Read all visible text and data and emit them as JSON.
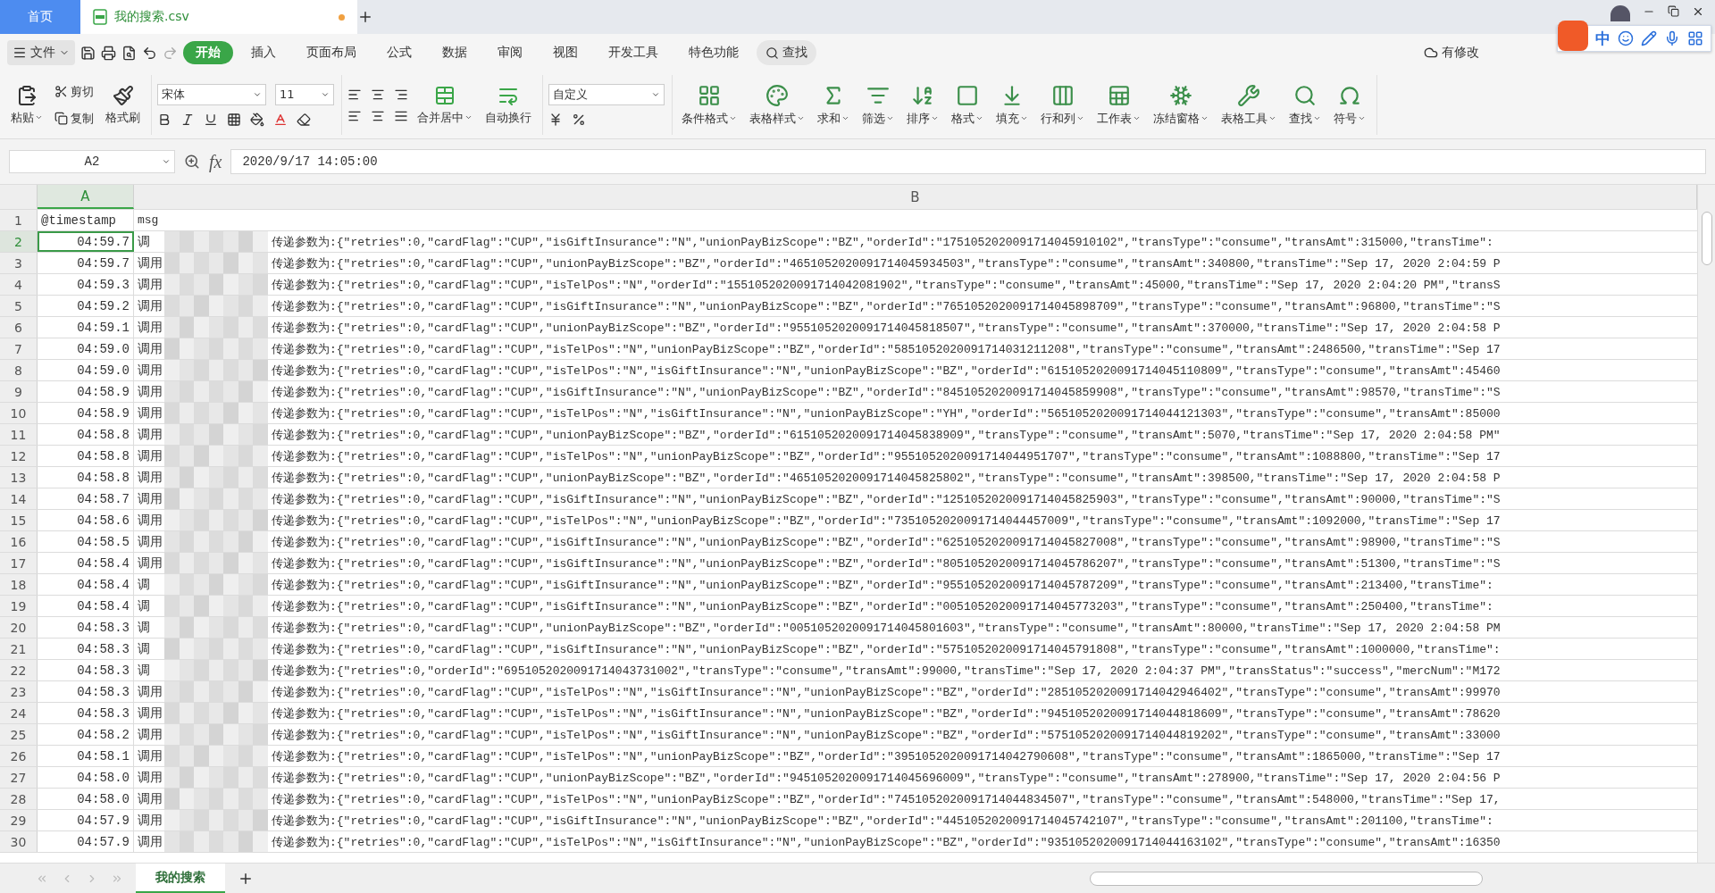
{
  "tabs": [
    {
      "label": "首页",
      "kind": "home",
      "selected": false
    },
    {
      "label": "我的搜索.csv",
      "kind": "file",
      "selected": true,
      "modified": true
    }
  ],
  "ime": {
    "mode": "中"
  },
  "menu": {
    "file": "文件",
    "items": [
      {
        "label": "开始",
        "selected": true
      },
      {
        "label": "插入",
        "selected": false
      },
      {
        "label": "页面布局",
        "selected": false
      },
      {
        "label": "公式",
        "selected": false
      },
      {
        "label": "数据",
        "selected": false
      },
      {
        "label": "审阅",
        "selected": false
      },
      {
        "label": "视图",
        "selected": false
      },
      {
        "label": "开发工具",
        "selected": false
      },
      {
        "label": "特色功能",
        "selected": false
      }
    ],
    "search": "查找",
    "changes": "有修改"
  },
  "ribbon": {
    "paste": "粘贴",
    "cut": "剪切",
    "copy": "复制",
    "format_painter": "格式刷",
    "font_name": "宋体",
    "font_size": "11",
    "merge": "合并居中",
    "wrap": "自动换行",
    "number_format": "自定义",
    "tools": [
      "条件格式",
      "表格样式",
      "求和",
      "筛选",
      "排序",
      "格式",
      "填充",
      "行和列",
      "工作表",
      "冻结窗格",
      "表格工具",
      "查找",
      "符号"
    ]
  },
  "formula_bar": {
    "cell": "A2",
    "fx": "fx",
    "value": "2020/9/17 14:05:00"
  },
  "sheet": {
    "columns": [
      "A",
      "B"
    ],
    "header_row": {
      "number": "1",
      "cells": [
        "@timestamp",
        "msg"
      ]
    },
    "rows": [
      {
        "number": "2",
        "kind": "data",
        "timestamp": "04:59.7",
        "prefix": "调",
        "msg": "传递参数为:{\"retries\":0,\"cardFlag\":\"CUP\",\"isGiftInsurance\":\"N\",\"unionPayBizScope\":\"BZ\",\"orderId\":\"1751052020091714045910102\",\"transType\":\"consume\",\"transAmt\":315000,\"transTime\":",
        "selected": true
      },
      {
        "number": "3",
        "kind": "data",
        "timestamp": "04:59.7",
        "prefix": "调用",
        "msg": "传递参数为:{\"retries\":0,\"cardFlag\":\"CUP\",\"unionPayBizScope\":\"BZ\",\"orderId\":\"4651052020091714045934503\",\"transType\":\"consume\",\"transAmt\":340800,\"transTime\":\"Sep 17, 2020 2:04:59 P",
        "selected": false
      },
      {
        "number": "4",
        "kind": "data",
        "timestamp": "04:59.3",
        "prefix": "调用",
        "msg": "传递参数为:{\"retries\":0,\"cardFlag\":\"CUP\",\"isTelPos\":\"N\",\"orderId\":\"1551052020091714042081902\",\"transType\":\"consume\",\"transAmt\":45000,\"transTime\":\"Sep 17, 2020 2:04:20 PM\",\"transS",
        "selected": false
      },
      {
        "number": "5",
        "kind": "data",
        "timestamp": "04:59.2",
        "prefix": "调用",
        "msg": "传递参数为:{\"retries\":0,\"cardFlag\":\"CUP\",\"isGiftInsurance\":\"N\",\"unionPayBizScope\":\"BZ\",\"orderId\":\"7651052020091714045898709\",\"transType\":\"consume\",\"transAmt\":96800,\"transTime\":\"S",
        "selected": false
      },
      {
        "number": "6",
        "kind": "data",
        "timestamp": "04:59.1",
        "prefix": "调用",
        "msg": "传递参数为:{\"retries\":0,\"cardFlag\":\"CUP\",\"unionPayBizScope\":\"BZ\",\"orderId\":\"9551052020091714045818507\",\"transType\":\"consume\",\"transAmt\":370000,\"transTime\":\"Sep 17, 2020 2:04:58 P",
        "selected": false
      },
      {
        "number": "7",
        "kind": "data",
        "timestamp": "04:59.0",
        "prefix": "调用",
        "msg": "传递参数为:{\"retries\":0,\"cardFlag\":\"CUP\",\"isTelPos\":\"N\",\"unionPayBizScope\":\"BZ\",\"orderId\":\"5851052020091714031211208\",\"transType\":\"consume\",\"transAmt\":2486500,\"transTime\":\"Sep 17",
        "selected": false
      },
      {
        "number": "8",
        "kind": "data",
        "timestamp": "04:59.0",
        "prefix": "调用",
        "msg": "传递参数为:{\"retries\":0,\"cardFlag\":\"CUP\",\"isTelPos\":\"N\",\"isGiftInsurance\":\"N\",\"unionPayBizScope\":\"BZ\",\"orderId\":\"6151052020091714045110809\",\"transType\":\"consume\",\"transAmt\":45460",
        "selected": false
      },
      {
        "number": "9",
        "kind": "data",
        "timestamp": "04:58.9",
        "prefix": "调用",
        "msg": "传递参数为:{\"retries\":0,\"cardFlag\":\"CUP\",\"isGiftInsurance\":\"N\",\"unionPayBizScope\":\"BZ\",\"orderId\":\"8451052020091714045859908\",\"transType\":\"consume\",\"transAmt\":98570,\"transTime\":\"S",
        "selected": false
      },
      {
        "number": "10",
        "kind": "data",
        "timestamp": "04:58.9",
        "prefix": "调用",
        "msg": "传递参数为:{\"retries\":0,\"cardFlag\":\"CUP\",\"isTelPos\":\"N\",\"isGiftInsurance\":\"N\",\"unionPayBizScope\":\"YH\",\"orderId\":\"5651052020091714044121303\",\"transType\":\"consume\",\"transAmt\":85000",
        "selected": false
      },
      {
        "number": "11",
        "kind": "data",
        "timestamp": "04:58.8",
        "prefix": "调用",
        "msg": "传递参数为:{\"retries\":0,\"cardFlag\":\"CUP\",\"unionPayBizScope\":\"BZ\",\"orderId\":\"6151052020091714045838909\",\"transType\":\"consume\",\"transAmt\":5070,\"transTime\":\"Sep 17, 2020 2:04:58 PM\"",
        "selected": false
      },
      {
        "number": "12",
        "kind": "data",
        "timestamp": "04:58.8",
        "prefix": "调用",
        "msg": "传递参数为:{\"retries\":0,\"cardFlag\":\"CUP\",\"isTelPos\":\"N\",\"unionPayBizScope\":\"BZ\",\"orderId\":\"9551052020091714044951707\",\"transType\":\"consume\",\"transAmt\":1088800,\"transTime\":\"Sep 17",
        "selected": false
      },
      {
        "number": "13",
        "kind": "data",
        "timestamp": "04:58.8",
        "prefix": "调用",
        "msg": "传递参数为:{\"retries\":0,\"cardFlag\":\"CUP\",\"unionPayBizScope\":\"BZ\",\"orderId\":\"4651052020091714045825802\",\"transType\":\"consume\",\"transAmt\":398500,\"transTime\":\"Sep 17, 2020 2:04:58 P",
        "selected": false
      },
      {
        "number": "14",
        "kind": "data",
        "timestamp": "04:58.7",
        "prefix": "调用",
        "msg": "传递参数为:{\"retries\":0,\"cardFlag\":\"CUP\",\"isGiftInsurance\":\"N\",\"unionPayBizScope\":\"BZ\",\"orderId\":\"1251052020091714045825903\",\"transType\":\"consume\",\"transAmt\":90000,\"transTime\":\"S",
        "selected": false
      },
      {
        "number": "15",
        "kind": "data",
        "timestamp": "04:58.6",
        "prefix": "调用",
        "msg": "传递参数为:{\"retries\":0,\"cardFlag\":\"CUP\",\"isTelPos\":\"N\",\"unionPayBizScope\":\"BZ\",\"orderId\":\"7351052020091714044457009\",\"transType\":\"consume\",\"transAmt\":1092000,\"transTime\":\"Sep 17",
        "selected": false
      },
      {
        "number": "16",
        "kind": "data",
        "timestamp": "04:58.5",
        "prefix": "调用",
        "msg": "传递参数为:{\"retries\":0,\"cardFlag\":\"CUP\",\"isGiftInsurance\":\"N\",\"unionPayBizScope\":\"BZ\",\"orderId\":\"6251052020091714045827008\",\"transType\":\"consume\",\"transAmt\":98900,\"transTime\":\"S",
        "selected": false
      },
      {
        "number": "17",
        "kind": "data",
        "timestamp": "04:58.4",
        "prefix": "调用",
        "msg": "传递参数为:{\"retries\":0,\"cardFlag\":\"CUP\",\"isGiftInsurance\":\"N\",\"unionPayBizScope\":\"BZ\",\"orderId\":\"8051052020091714045786207\",\"transType\":\"consume\",\"transAmt\":51300,\"transTime\":\"S",
        "selected": false
      },
      {
        "number": "18",
        "kind": "data",
        "timestamp": "04:58.4",
        "prefix": "调",
        "msg": "传递参数为:{\"retries\":0,\"cardFlag\":\"CUP\",\"isGiftInsurance\":\"N\",\"unionPayBizScope\":\"BZ\",\"orderId\":\"9551052020091714045787209\",\"transType\":\"consume\",\"transAmt\":213400,\"transTime\":",
        "selected": false
      },
      {
        "number": "19",
        "kind": "data",
        "timestamp": "04:58.4",
        "prefix": "调",
        "msg": "传递参数为:{\"retries\":0,\"cardFlag\":\"CUP\",\"isGiftInsurance\":\"N\",\"unionPayBizScope\":\"BZ\",\"orderId\":\"0051052020091714045773203\",\"transType\":\"consume\",\"transAmt\":250400,\"transTime\":",
        "selected": false
      },
      {
        "number": "20",
        "kind": "data",
        "timestamp": "04:58.3",
        "prefix": "调",
        "msg": "传递参数为:{\"retries\":0,\"cardFlag\":\"CUP\",\"unionPayBizScope\":\"BZ\",\"orderId\":\"0051052020091714045801603\",\"transType\":\"consume\",\"transAmt\":80000,\"transTime\":\"Sep 17, 2020 2:04:58 PM",
        "selected": false
      },
      {
        "number": "21",
        "kind": "data",
        "timestamp": "04:58.3",
        "prefix": "调",
        "msg": "传递参数为:{\"retries\":0,\"cardFlag\":\"CUP\",\"isGiftInsurance\":\"N\",\"unionPayBizScope\":\"BZ\",\"orderId\":\"5751052020091714045791808\",\"transType\":\"consume\",\"transAmt\":1000000,\"transTime\":",
        "selected": false
      },
      {
        "number": "22",
        "kind": "data",
        "timestamp": "04:58.3",
        "prefix": "调",
        "msg": "传递参数为:{\"retries\":0,\"orderId\":\"6951052020091714043731002\",\"transType\":\"consume\",\"transAmt\":99000,\"transTime\":\"Sep 17, 2020 2:04:37 PM\",\"transStatus\":\"success\",\"mercNum\":\"M172",
        "selected": false
      },
      {
        "number": "23",
        "kind": "data",
        "timestamp": "04:58.3",
        "prefix": "调用",
        "msg": "传递参数为:{\"retries\":0,\"cardFlag\":\"CUP\",\"isTelPos\":\"N\",\"isGiftInsurance\":\"N\",\"unionPayBizScope\":\"BZ\",\"orderId\":\"2851052020091714042946402\",\"transType\":\"consume\",\"transAmt\":99970",
        "selected": false
      },
      {
        "number": "24",
        "kind": "data",
        "timestamp": "04:58.3",
        "prefix": "调用",
        "msg": "传递参数为:{\"retries\":0,\"cardFlag\":\"CUP\",\"isTelPos\":\"N\",\"isGiftInsurance\":\"N\",\"unionPayBizScope\":\"BZ\",\"orderId\":\"9451052020091714044818609\",\"transType\":\"consume\",\"transAmt\":78620",
        "selected": false
      },
      {
        "number": "25",
        "kind": "data",
        "timestamp": "04:58.2",
        "prefix": "调用",
        "msg": "传递参数为:{\"retries\":0,\"cardFlag\":\"CUP\",\"isTelPos\":\"N\",\"isGiftInsurance\":\"N\",\"unionPayBizScope\":\"BZ\",\"orderId\":\"5751052020091714044819202\",\"transType\":\"consume\",\"transAmt\":33000",
        "selected": false
      },
      {
        "number": "26",
        "kind": "data",
        "timestamp": "04:58.1",
        "prefix": "调用",
        "msg": "传递参数为:{\"retries\":0,\"cardFlag\":\"CUP\",\"isTelPos\":\"N\",\"unionPayBizScope\":\"BZ\",\"orderId\":\"3951052020091714042790608\",\"transType\":\"consume\",\"transAmt\":1865000,\"transTime\":\"Sep 17",
        "selected": false
      },
      {
        "number": "27",
        "kind": "data",
        "timestamp": "04:58.0",
        "prefix": "调用",
        "msg": "传递参数为:{\"retries\":0,\"cardFlag\":\"CUP\",\"unionPayBizScope\":\"BZ\",\"orderId\":\"9451052020091714045696009\",\"transType\":\"consume\",\"transAmt\":278900,\"transTime\":\"Sep 17, 2020 2:04:56 P",
        "selected": false
      },
      {
        "number": "28",
        "kind": "data",
        "timestamp": "04:58.0",
        "prefix": "调用",
        "msg": "传递参数为:{\"retries\":0,\"cardFlag\":\"CUP\",\"isTelPos\":\"N\",\"unionPayBizScope\":\"BZ\",\"orderId\":\"7451052020091714044834507\",\"transType\":\"consume\",\"transAmt\":548000,\"transTime\":\"Sep 17,",
        "selected": false
      },
      {
        "number": "29",
        "kind": "data",
        "timestamp": "04:57.9",
        "prefix": "调用",
        "msg": "传递参数为:{\"retries\":0,\"cardFlag\":\"CUP\",\"isGiftInsurance\":\"N\",\"unionPayBizScope\":\"BZ\",\"orderId\":\"4451052020091714045742107\",\"transType\":\"consume\",\"transAmt\":201100,\"transTime\":",
        "selected": false
      },
      {
        "number": "30",
        "kind": "data",
        "timestamp": "04:57.9",
        "prefix": "调用",
        "msg": "传递参数为:{\"retries\":0,\"cardFlag\":\"CUP\",\"isTelPos\":\"N\",\"isGiftInsurance\":\"N\",\"unionPayBizScope\":\"BZ\",\"orderId\":\"9351052020091714044163102\",\"transType\":\"consume\",\"transAmt\":16350",
        "selected": false
      }
    ]
  },
  "sheet_tabs": [
    {
      "label": "我的搜索",
      "selected": true
    }
  ]
}
